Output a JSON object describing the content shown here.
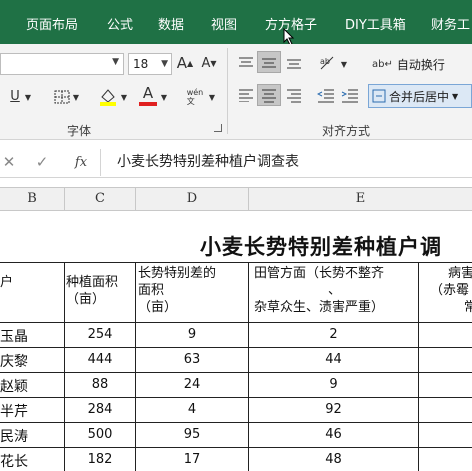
{
  "ribbon_tabs": [
    "页面布局",
    "公式",
    "数据",
    "视图",
    "方方格子",
    "DIY工具箱",
    "财务工"
  ],
  "font": {
    "size": "18",
    "group_label": "字体"
  },
  "alignment": {
    "wrap_text_label": "自动换行",
    "merge_label": "合并后居中",
    "group_label": "对齐方式"
  },
  "formula_bar": {
    "fx": "fx",
    "content": "小麦长势特别差种植户调查表"
  },
  "columns": [
    "B",
    "C",
    "D",
    "E"
  ],
  "sheet": {
    "title": "小麦长势特别差种植户调",
    "headers": {
      "b": "户",
      "c": [
        "种植面积",
        "（亩）"
      ],
      "d": [
        "长势特别差的",
        "面积",
        "（亩）"
      ],
      "e": [
        "田管方面（长势不整齐",
        "、",
        "杂草众生、渍害严重）"
      ],
      "f": [
        "病害",
        "（赤霉",
        "常"
      ]
    },
    "rows": [
      {
        "name": "玉晶",
        "area": "254",
        "bad_area": "9",
        "field_mgmt": "2"
      },
      {
        "name": "庆黎",
        "area": "444",
        "bad_area": "63",
        "field_mgmt": "44"
      },
      {
        "name": "赵颖",
        "area": "88",
        "bad_area": "24",
        "field_mgmt": "9"
      },
      {
        "name": "半芹",
        "area": "284",
        "bad_area": "4",
        "field_mgmt": "92"
      },
      {
        "name": "民涛",
        "area": "500",
        "bad_area": "95",
        "field_mgmt": "46"
      },
      {
        "name": "花长",
        "area": "182",
        "bad_area": "17",
        "field_mgmt": "48"
      }
    ]
  },
  "colors": {
    "ribbon_tab_bg": "#1f7145",
    "font_color_red": "#e02020",
    "highlight_yellow": "#ffff00"
  }
}
